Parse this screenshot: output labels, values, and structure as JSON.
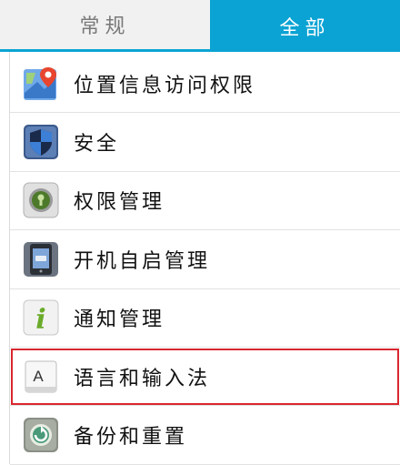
{
  "tabs": [
    {
      "label": "常规",
      "active": false
    },
    {
      "label": "全部",
      "active": true
    }
  ],
  "settings_items": [
    {
      "label": "位置信息访问权限",
      "icon": "location-icon"
    },
    {
      "label": "安全",
      "icon": "shield-icon"
    },
    {
      "label": "权限管理",
      "icon": "lock-icon"
    },
    {
      "label": "开机自启管理",
      "icon": "phone-icon"
    },
    {
      "label": "通知管理",
      "icon": "info-icon"
    },
    {
      "label": "语言和输入法",
      "icon": "keyboard-key-icon",
      "highlighted": true
    },
    {
      "label": "备份和重置",
      "icon": "backup-restore-icon"
    }
  ],
  "icon_glyphs": {
    "keyboard_key": "A",
    "info": "i"
  },
  "colors": {
    "accent": "#0aa3d4",
    "highlight_border": "#d9272f"
  }
}
